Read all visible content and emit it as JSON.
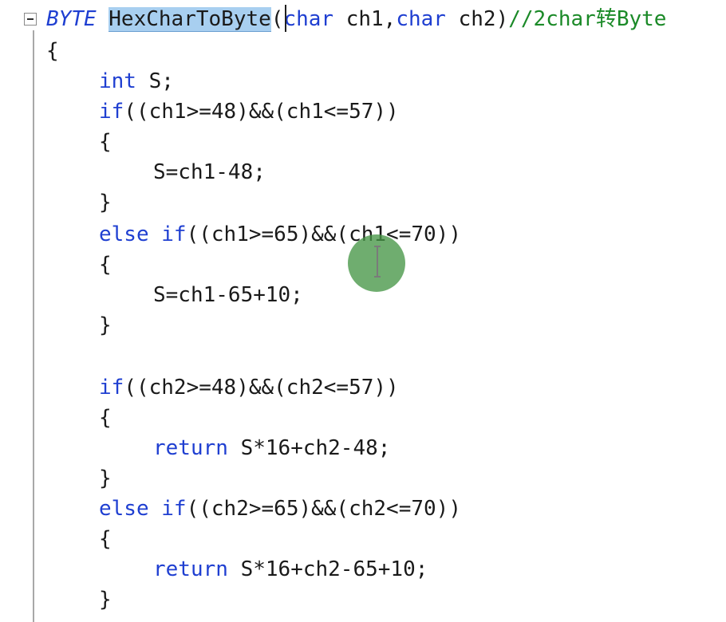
{
  "editor": {
    "lines": [
      {
        "indent": 0,
        "tokens": [
          {
            "cls": "type-it",
            "text": "BYTE"
          },
          {
            "cls": "",
            "text": " "
          },
          {
            "cls": "sel",
            "text": "HexCharToByte"
          },
          {
            "cls": "",
            "text": "("
          },
          {
            "cls": "kw",
            "text": "char"
          },
          {
            "cls": "",
            "text": " ch1,"
          },
          {
            "cls": "kw",
            "text": "char"
          },
          {
            "cls": "",
            "text": " ch2)"
          },
          {
            "cls": "cmt",
            "text": "//2char转Byte"
          }
        ]
      },
      {
        "indent": 0,
        "tokens": [
          {
            "cls": "",
            "text": "{"
          }
        ]
      },
      {
        "indent": 1,
        "tokens": [
          {
            "cls": "kw",
            "text": "int"
          },
          {
            "cls": "",
            "text": " S;"
          }
        ]
      },
      {
        "indent": 1,
        "tokens": [
          {
            "cls": "kw",
            "text": "if"
          },
          {
            "cls": "",
            "text": "((ch1>=48)&&(ch1<=57))"
          }
        ]
      },
      {
        "indent": 1,
        "tokens": [
          {
            "cls": "",
            "text": "{"
          }
        ]
      },
      {
        "indent": 2,
        "tokens": [
          {
            "cls": "",
            "text": "S=ch1-48;"
          }
        ]
      },
      {
        "indent": 1,
        "tokens": [
          {
            "cls": "",
            "text": "}"
          }
        ]
      },
      {
        "indent": 1,
        "tokens": [
          {
            "cls": "kw",
            "text": "else"
          },
          {
            "cls": "",
            "text": " "
          },
          {
            "cls": "kw",
            "text": "if"
          },
          {
            "cls": "",
            "text": "((ch1>=65)&&(ch1<=70))"
          }
        ]
      },
      {
        "indent": 1,
        "tokens": [
          {
            "cls": "",
            "text": "{"
          }
        ]
      },
      {
        "indent": 2,
        "tokens": [
          {
            "cls": "",
            "text": "S=ch1-65+10;"
          }
        ]
      },
      {
        "indent": 1,
        "tokens": [
          {
            "cls": "",
            "text": "}"
          }
        ]
      },
      {
        "indent": 1,
        "tokens": []
      },
      {
        "indent": 1,
        "tokens": [
          {
            "cls": "kw",
            "text": "if"
          },
          {
            "cls": "",
            "text": "((ch2>=48)&&(ch2<=57))"
          }
        ]
      },
      {
        "indent": 1,
        "tokens": [
          {
            "cls": "",
            "text": "{"
          }
        ]
      },
      {
        "indent": 2,
        "tokens": [
          {
            "cls": "kw",
            "text": "return"
          },
          {
            "cls": "",
            "text": " S*16+ch2-48;"
          }
        ]
      },
      {
        "indent": 1,
        "tokens": [
          {
            "cls": "",
            "text": "}"
          }
        ]
      },
      {
        "indent": 1,
        "tokens": [
          {
            "cls": "kw",
            "text": "else"
          },
          {
            "cls": "",
            "text": " "
          },
          {
            "cls": "kw",
            "text": "if"
          },
          {
            "cls": "",
            "text": "((ch2>=65)&&(ch2<=70))"
          }
        ]
      },
      {
        "indent": 1,
        "tokens": [
          {
            "cls": "",
            "text": "{"
          }
        ]
      },
      {
        "indent": 2,
        "tokens": [
          {
            "cls": "kw",
            "text": "return"
          },
          {
            "cls": "",
            "text": " S*16+ch2-65+10;"
          }
        ]
      },
      {
        "indent": 1,
        "tokens": [
          {
            "cls": "",
            "text": "}"
          }
        ]
      }
    ]
  },
  "colors": {
    "keyword": "#1f3fd1",
    "comment": "#1b8a28",
    "selection": "#a8cff0",
    "cursor_highlight": "#4a964a"
  },
  "icons": {
    "fold": "collapse-minus-icon",
    "pointer": "text-ibeam-cursor-icon"
  }
}
